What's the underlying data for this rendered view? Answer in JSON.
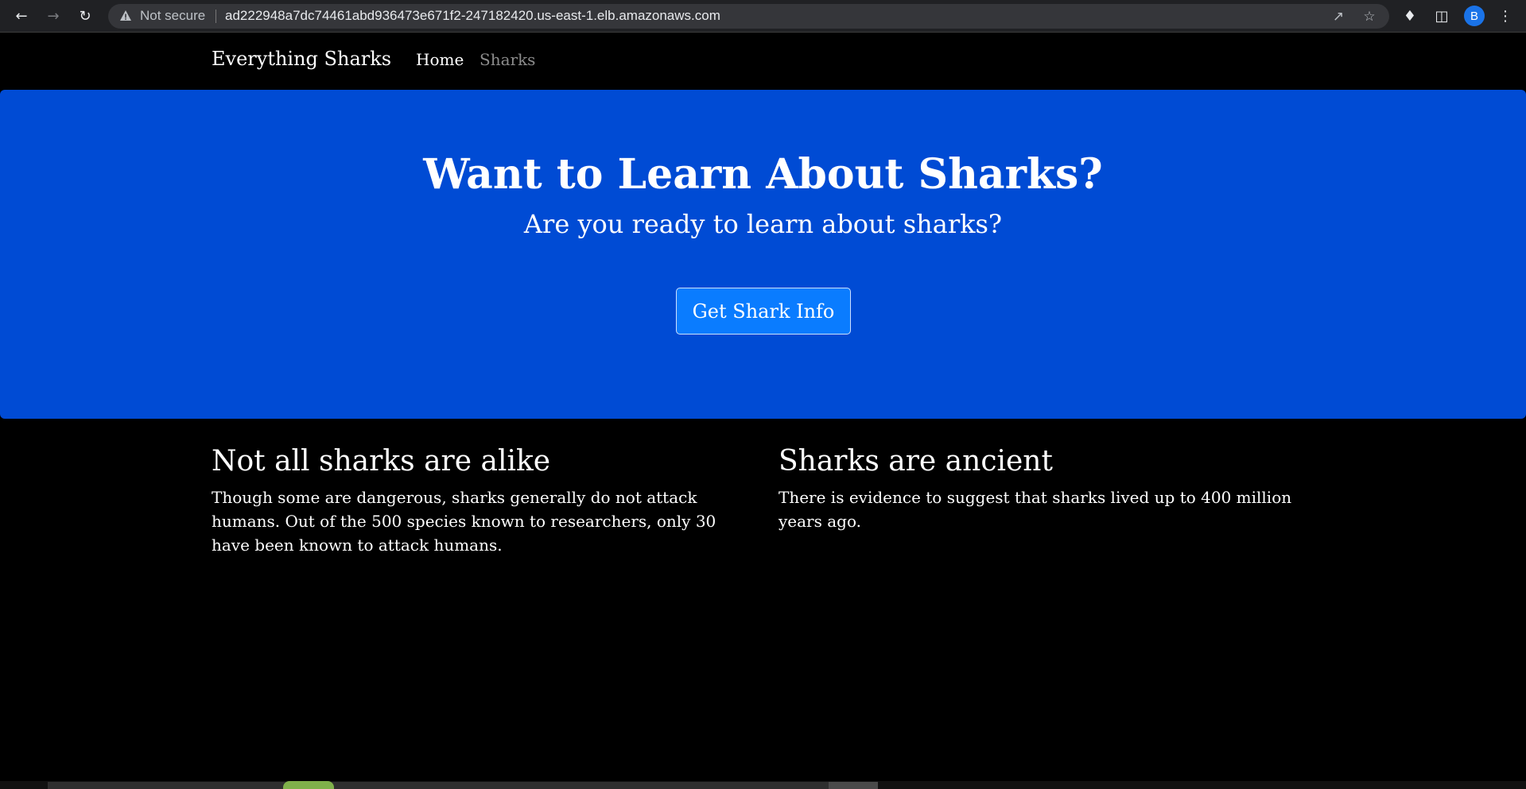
{
  "browser": {
    "back_icon": "arrow-left-icon",
    "forward_icon": "arrow-right-icon",
    "reload_icon": "reload-icon",
    "security_label": "Not secure",
    "url": "ad222948a7dc74461abd936473e671f2-247182420.us-east-1.elb.amazonaws.com",
    "profile_initial": "B"
  },
  "navbar": {
    "brand": "Everything Sharks",
    "links": [
      {
        "label": "Home"
      },
      {
        "label": "Sharks"
      }
    ]
  },
  "hero": {
    "title": "Want to Learn About Sharks?",
    "subtitle": "Are you ready to learn about sharks?",
    "button_label": "Get Shark Info",
    "background_color": "#004bd4",
    "button_color": "#0a7cff"
  },
  "sections": [
    {
      "heading": "Not all sharks are alike",
      "body": "Though some are dangerous, sharks generally do not attack humans. Out of the 500 species known to researchers, only 30 have been known to attack humans."
    },
    {
      "heading": "Sharks are ancient",
      "body": "There is evidence to suggest that sharks lived up to 400 million years ago."
    }
  ]
}
